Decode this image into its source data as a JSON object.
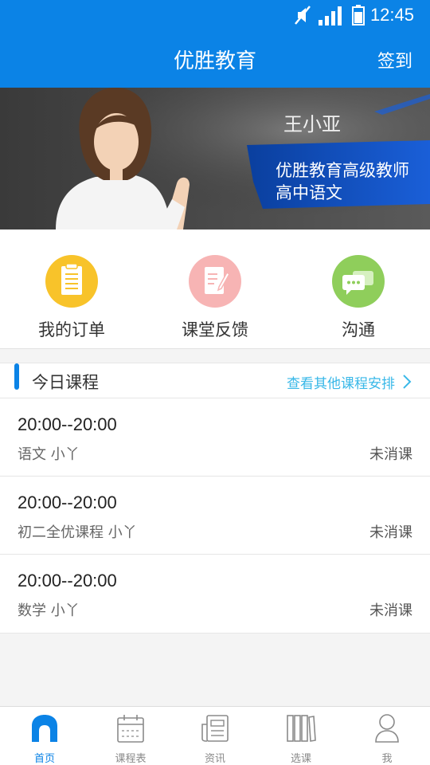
{
  "status": {
    "time": "12:45"
  },
  "appbar": {
    "title": "优胜教育",
    "signin": "签到"
  },
  "banner": {
    "name": "王小亚",
    "subtitle1": "优胜教育高级教师",
    "subtitle2": "高中语文"
  },
  "quick": [
    {
      "label": "我的订单",
      "icon": "order-icon",
      "color": "#f8c32a"
    },
    {
      "label": "课堂反馈",
      "icon": "feedback-icon",
      "color": "#f7b4b4"
    },
    {
      "label": "沟通",
      "icon": "chat-icon",
      "color": "#8fce5b"
    }
  ],
  "today": {
    "title": "今日课程",
    "more": "查看其他课程安排",
    "items": [
      {
        "time": "20:00--20:00",
        "course": "语文   小丫",
        "state": "未消课"
      },
      {
        "time": "20:00--20:00",
        "course": "初二全优课程   小丫",
        "state": "未消课"
      },
      {
        "time": "20:00--20:00",
        "course": "数学   小丫",
        "state": "未消课"
      }
    ]
  },
  "tabs": [
    {
      "label": "首页",
      "icon": "home-icon",
      "active": true
    },
    {
      "label": "课程表",
      "icon": "calendar-icon",
      "active": false
    },
    {
      "label": "资讯",
      "icon": "news-icon",
      "active": false
    },
    {
      "label": "选课",
      "icon": "books-icon",
      "active": false
    },
    {
      "label": "我",
      "icon": "profile-icon",
      "active": false
    }
  ],
  "colors": {
    "primary": "#0b83e6",
    "link": "#39b8e8"
  }
}
